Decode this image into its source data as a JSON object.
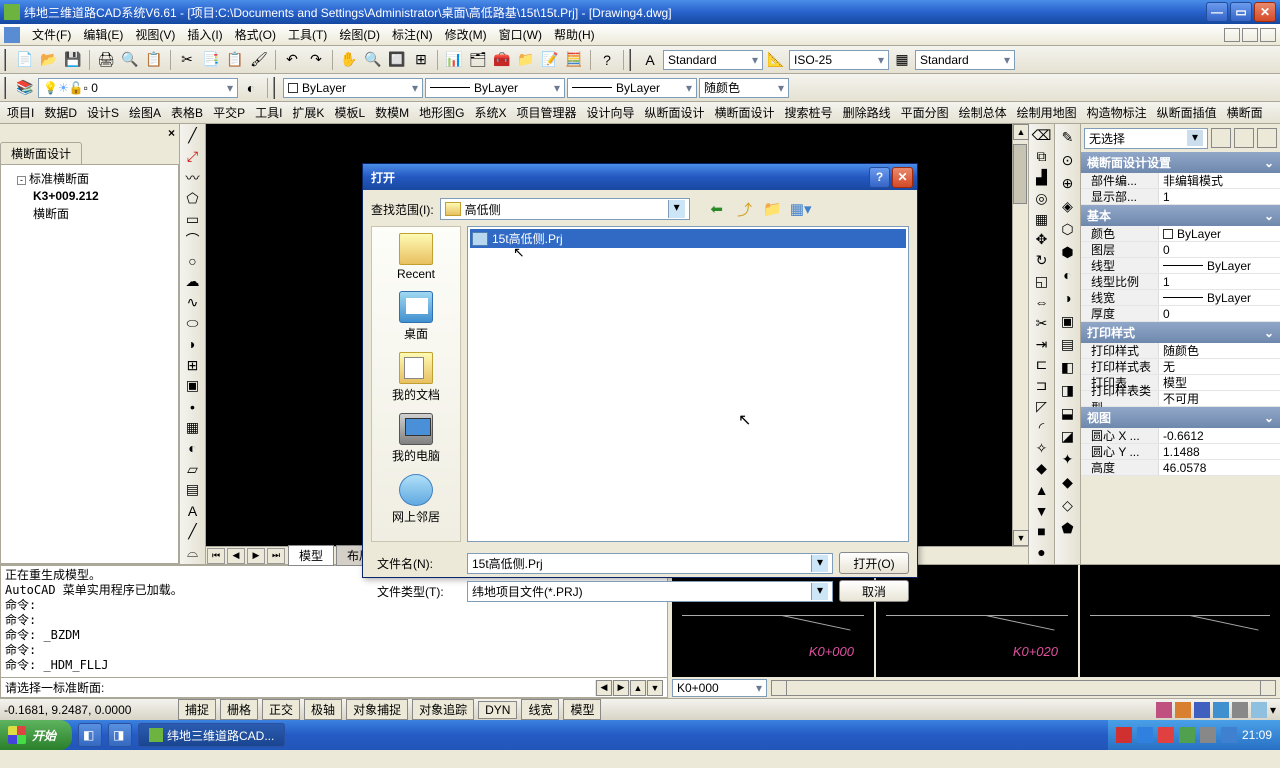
{
  "titlebar": {
    "text": "纬地三维道路CAD系统V6.61 - [项目:C:\\Documents and Settings\\Administrator\\桌面\\高低路基\\15t\\15t.Prj] - [Drawing4.dwg]"
  },
  "menubar": {
    "items": [
      "文件(F)",
      "编辑(E)",
      "视图(V)",
      "插入(I)",
      "格式(O)",
      "工具(T)",
      "绘图(D)",
      "标注(N)",
      "修改(M)",
      "窗口(W)",
      "帮助(H)"
    ]
  },
  "toolbar2": {
    "layer_combo": "0",
    "bylayer1": "ByLayer",
    "bylayer2": "ByLayer",
    "bylayer3": "ByLayer",
    "color_combo": "随颜色"
  },
  "style_row": {
    "style1": "Standard",
    "style2": "ISO-25",
    "style3": "Standard"
  },
  "cmdbar": {
    "items": [
      "项目I",
      "数据D",
      "设计S",
      "绘图A",
      "表格B",
      "平交P",
      "工具I",
      "扩展K",
      "模板L",
      "数模M",
      "地形图G",
      "系统X",
      "项目管理器",
      "设计向导",
      "纵断面设计",
      "横断面设计",
      "搜索桩号",
      "删除路线",
      "平面分图",
      "绘制总体",
      "绘制用地图",
      "构造物标注",
      "纵断面插值",
      "横断面"
    ]
  },
  "left_panel": {
    "tab": "横断面设计",
    "tree": {
      "root": "标准横断面",
      "child1": "K3+009.212",
      "child2": "横断面"
    }
  },
  "sheet_tabs": {
    "active": "模型",
    "others": [
      "布局"
    ]
  },
  "right_panel": {
    "selector": "无选择",
    "sections": {
      "s1": {
        "title": "横断面设计设置",
        "rows": [
          [
            "部件编...",
            "非编辑模式"
          ],
          [
            "显示部...",
            "1"
          ]
        ]
      },
      "s2": {
        "title": "基本",
        "rows": [
          [
            "颜色",
            "ByLayer"
          ],
          [
            "图层",
            "0"
          ],
          [
            "线型",
            "ByLayer"
          ],
          [
            "线型比例",
            "1"
          ],
          [
            "线宽",
            "ByLayer"
          ],
          [
            "厚度",
            "0"
          ]
        ]
      },
      "s3": {
        "title": "打印样式",
        "rows": [
          [
            "打印样式",
            "随颜色"
          ],
          [
            "打印样式表",
            "无"
          ],
          [
            "打印表...",
            "模型"
          ],
          [
            "打印样表类型",
            "不可用"
          ]
        ]
      },
      "s4": {
        "title": "视图",
        "rows": [
          [
            "圆心 X ...",
            "-0.6612"
          ],
          [
            "圆心 Y ...",
            "1.1488"
          ],
          [
            "高度",
            "46.0578"
          ]
        ]
      }
    }
  },
  "log": {
    "lines": "正在重生成模型。\nAutoCAD 菜单实用程序已加载。\n命令:\n命令:\n命令: _BZDM\n命令:\n命令: _HDM_FLLJ",
    "prompt": "请选择一标准断面:"
  },
  "previews": {
    "label1": "K0+000",
    "label2": "K0+020",
    "combo": "K0+000"
  },
  "statusbar": {
    "coords": "-0.1681, 9.2487, 0.0000",
    "modes": [
      "捕捉",
      "栅格",
      "正交",
      "极轴",
      "对象捕捉",
      "对象追踪",
      "DYN",
      "线宽",
      "模型"
    ]
  },
  "taskbar": {
    "start": "开始",
    "task1": "纬地三维道路CAD...",
    "clock": "21:09"
  },
  "dialog": {
    "title": "打开",
    "look_label": "查找范围(I):",
    "look_value": "高低侧",
    "file_item": "15t高低侧.Prj",
    "places": [
      "Recent",
      "桌面",
      "我的文档",
      "我的电脑",
      "网上邻居"
    ],
    "fn_label": "文件名(N):",
    "fn_value": "15t高低侧.Prj",
    "ft_label": "文件类型(T):",
    "ft_value": "纬地项目文件(*.PRJ)",
    "open_btn": "打开(O)",
    "cancel_btn": "取消"
  }
}
